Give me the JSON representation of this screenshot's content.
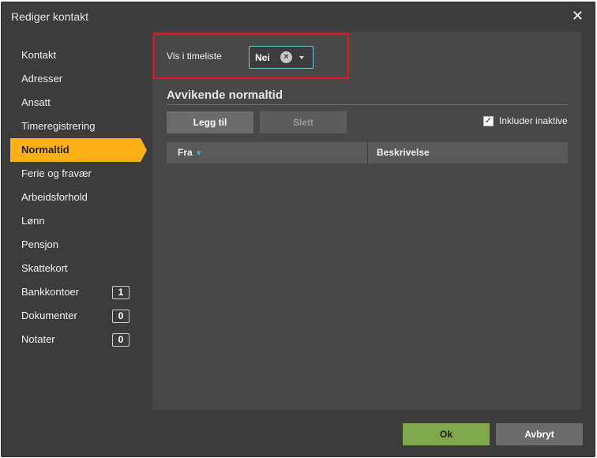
{
  "dialog": {
    "title": "Rediger kontakt",
    "close_symbol": "✕"
  },
  "sidebar": {
    "items": [
      {
        "label": "Kontakt"
      },
      {
        "label": "Adresser"
      },
      {
        "label": "Ansatt"
      },
      {
        "label": "Timeregistrering"
      },
      {
        "label": "Normaltid",
        "active": true
      },
      {
        "label": "Ferie og fravær"
      },
      {
        "label": "Arbeidsforhold"
      },
      {
        "label": "Lønn"
      },
      {
        "label": "Pensjon"
      },
      {
        "label": "Skattekort"
      },
      {
        "label": "Bankkontoer",
        "badge": "1"
      },
      {
        "label": "Dokumenter",
        "badge": "0"
      },
      {
        "label": "Notater",
        "badge": "0"
      }
    ]
  },
  "form": {
    "vis_label": "Vis i timeliste",
    "vis_value": "Nei"
  },
  "section": {
    "title": "Avvikende normaltid",
    "add_label": "Legg til",
    "delete_label": "Slett",
    "include_inactive_label": "Inkluder inaktive",
    "include_inactive_checked": true,
    "columns": [
      "Fra",
      "Beskrivelse"
    ]
  },
  "footer": {
    "ok_label": "Ok",
    "cancel_label": "Avbryt"
  },
  "colors": {
    "accent": "#fbb116",
    "ok": "#7fa84b",
    "highlight": "#e3161d",
    "select_border": "#76c6e8"
  },
  "icons": [
    "close-icon",
    "clear-icon",
    "caret-down-icon",
    "check-icon",
    "sort-down-icon"
  ]
}
